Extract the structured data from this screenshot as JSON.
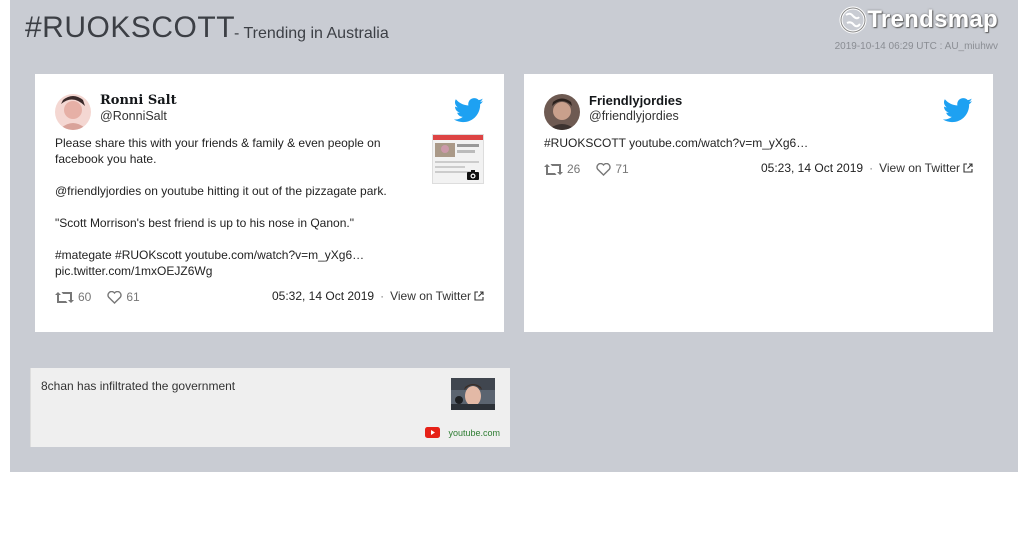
{
  "header": {
    "hashtag": "#RUOKSCOTT",
    "trending": "- Trending in Australia",
    "logo": "Trendsmap",
    "stamp": "2019-10-14 06:29 UTC : AU_miuhwv"
  },
  "tweets": [
    {
      "name": "Ronni Salt",
      "handle": "@RonniSalt",
      "paragraphs": [
        "Please share this with your friends & family & even people on facebook you hate.",
        "@friendlyjordies on youtube hitting it out of the pizzagate park.",
        "\"Scott Morrison's best friend is up to his nose in Qanon.\"",
        "#mategate #RUOKscott youtube.com/watch?v=m_yXg6… pic.twitter.com/1mxOEJZ6Wg"
      ],
      "retweets": "60",
      "likes": "61",
      "time": "05:32, 14 Oct 2019",
      "view_label": "View on Twitter"
    },
    {
      "name": "Friendlyjordies",
      "handle": "@friendlyjordies",
      "paragraphs": [
        "#RUOKSCOTT youtube.com/watch?v=m_yXg6…"
      ],
      "retweets": "26",
      "likes": "71",
      "time": "05:23, 14 Oct 2019",
      "view_label": "View on Twitter"
    }
  ],
  "video": {
    "title": "8chan has infiltrated the government",
    "source": "youtube.com"
  },
  "colors": {
    "frame": "#c9ccd3",
    "twitter_blue": "#1da1f2",
    "youtube_red": "#e62117"
  }
}
